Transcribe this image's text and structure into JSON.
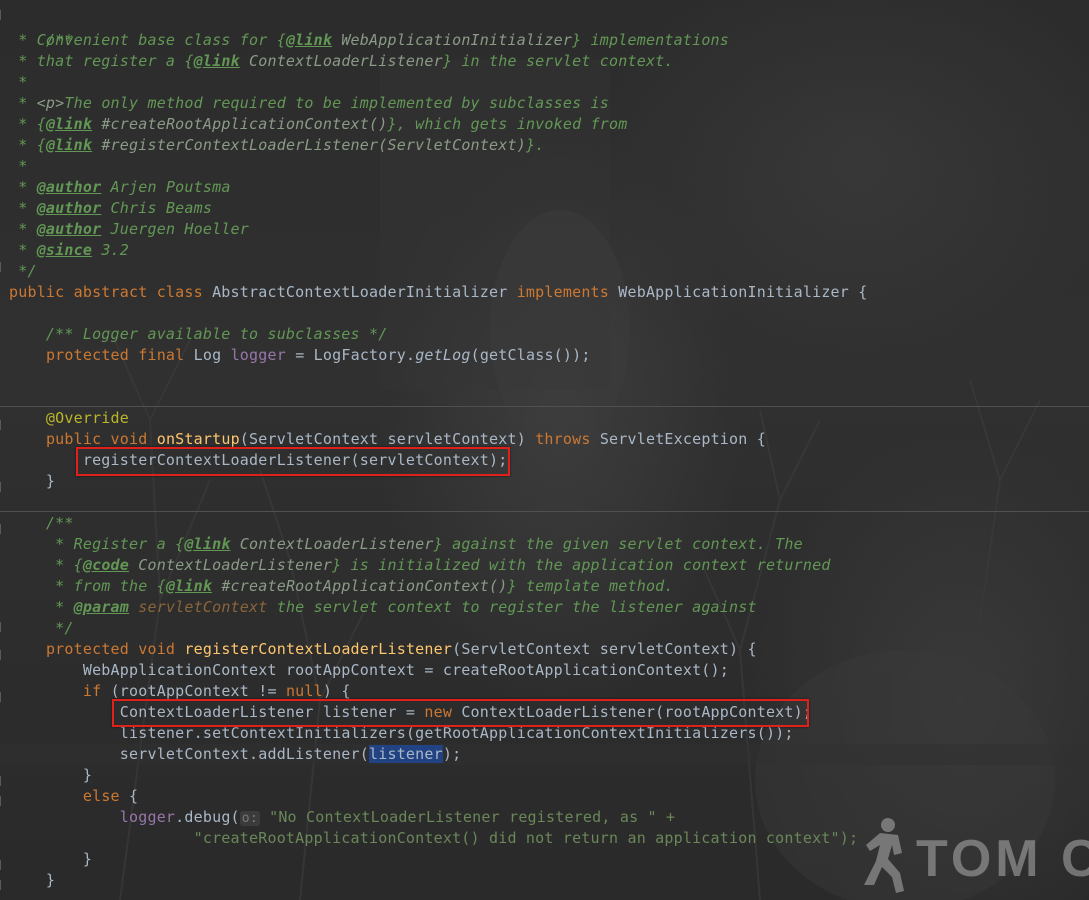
{
  "editor": {
    "theme_colors": {
      "background": "#2b2b2b",
      "doc_comment": "#629755",
      "keyword": "#cc7832",
      "method_decl": "#ffc66d",
      "field": "#9876aa",
      "annotation": "#bbb529",
      "string": "#6a8759",
      "plain": "#a9b7c6",
      "highlight_box": "#e0201a"
    },
    "lines": {
      "l1": [
        "/**"
      ],
      "l2": [
        " * Convenient base class for ",
        "{",
        "@link",
        " WebApplicationInitializer",
        "}",
        " implementations"
      ],
      "l3": [
        " * that register a ",
        "{",
        "@link",
        " ContextLoaderListener",
        "}",
        " in the servlet context."
      ],
      "l4": [
        " *"
      ],
      "l5": [
        " * ",
        "<p>",
        "The only method required to be implemented by subclasses is"
      ],
      "l6": [
        " * ",
        "{",
        "@link",
        " #createRootApplicationContext()",
        "}",
        ", which gets invoked from"
      ],
      "l7": [
        " * ",
        "{",
        "@link",
        " #registerContextLoaderListener(ServletContext)",
        "}",
        "."
      ],
      "l8": [
        " *"
      ],
      "l9": [
        " * ",
        "@author",
        " Arjen Poutsma"
      ],
      "l10": [
        " * ",
        "@author",
        " Chris Beams"
      ],
      "l11": [
        " * ",
        "@author",
        " Juergen Hoeller"
      ],
      "l12": [
        " * ",
        "@since",
        " 3.2"
      ],
      "l13": [
        " */"
      ],
      "l14": [
        "public abstract class ",
        "AbstractContextLoaderInitializer ",
        "implements ",
        "WebApplicationInitializer {"
      ],
      "l16": [
        "    /** Logger available to subclasses */"
      ],
      "l17": [
        "    ",
        "protected final ",
        "Log ",
        "logger",
        " = LogFactory.",
        "getLog",
        "(getClass());"
      ],
      "l20": [
        "    @Override"
      ],
      "l21": [
        "    ",
        "public void ",
        "onStartup",
        "(ServletContext servletContext) ",
        "throws ",
        "ServletException {"
      ],
      "l22": [
        "        registerContextLoaderListener(servletContext);"
      ],
      "l23": [
        "    }"
      ],
      "l25": [
        "    /**"
      ],
      "l26": [
        "     * Register a ",
        "{",
        "@link",
        " ContextLoaderListener",
        "}",
        " against the given servlet context. The"
      ],
      "l27": [
        "     * ",
        "{",
        "@code",
        " ContextLoaderListener",
        "}",
        " is initialized with the application context returned"
      ],
      "l28": [
        "     * from the ",
        "{",
        "@link",
        " #createRootApplicationContext()",
        "}",
        " template method."
      ],
      "l29": [
        "     * ",
        "@param",
        " servletContext",
        " the servlet context to register the listener against"
      ],
      "l30": [
        "     */"
      ],
      "l31": [
        "    ",
        "protected void ",
        "registerContextLoaderListener",
        "(ServletContext servletContext) {"
      ],
      "l32": [
        "        WebApplicationContext rootAppContext = createRootApplicationContext();"
      ],
      "l33": [
        "        ",
        "if ",
        "(rootAppContext != ",
        "null",
        ") {"
      ],
      "l34": [
        "            ContextLoaderListener listener = ",
        "new ",
        "ContextLoaderListener(rootAppContext);"
      ],
      "l35": [
        "            ",
        "listener",
        ".setContextInitializers(getRootApplicationContextInitializers());"
      ],
      "l36": [
        "            servletContext.addListener(",
        "listener",
        ");"
      ],
      "l37": [
        "        }"
      ],
      "l38": [
        "        ",
        "else ",
        "{"
      ],
      "l39": [
        "            ",
        "logger",
        ".debug(",
        "o:",
        " \"No ContextLoaderListener registered, as \" +"
      ],
      "l40": [
        "                    \"createRootApplicationContext() did not return an application context\");"
      ],
      "l41": [
        "        }"
      ],
      "l42": [
        "    }"
      ]
    }
  },
  "watermark": {
    "text": "TOM C"
  }
}
